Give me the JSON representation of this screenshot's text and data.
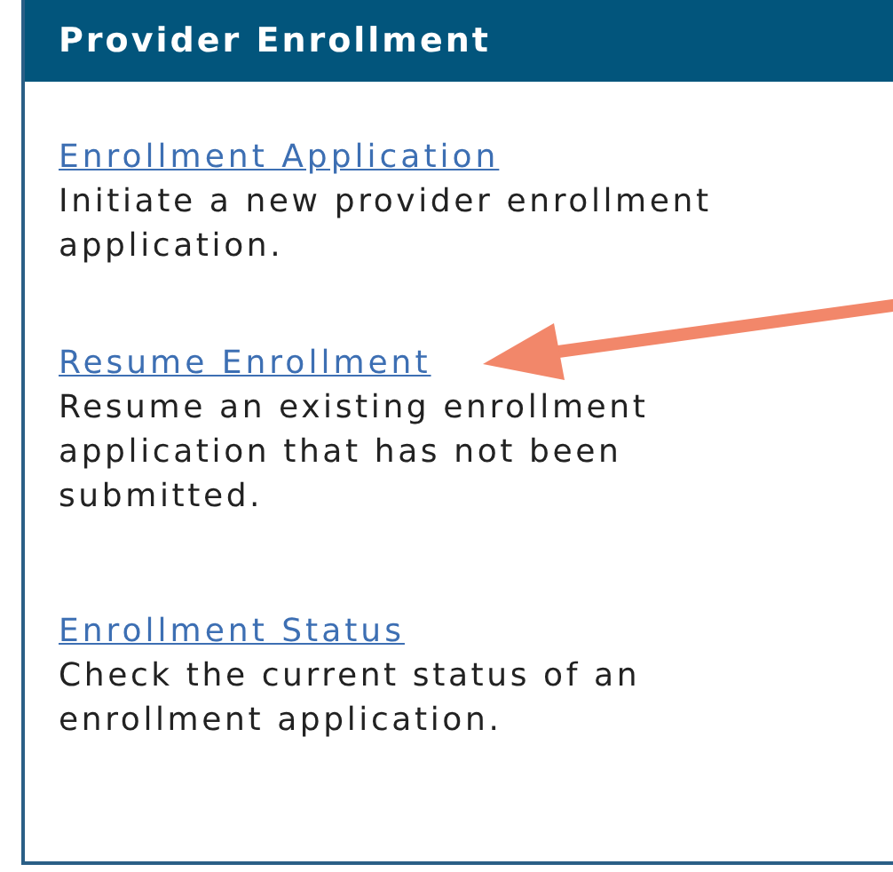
{
  "panel": {
    "title": "Provider Enrollment",
    "items": [
      {
        "link": "Enrollment Application",
        "description": "Initiate a new provider enrollment application."
      },
      {
        "link": "Resume Enrollment",
        "description": "Resume an existing enrollment application that has not been submitted."
      },
      {
        "link": "Enrollment Status",
        "description": "Check the current status of an enrollment application."
      }
    ]
  }
}
